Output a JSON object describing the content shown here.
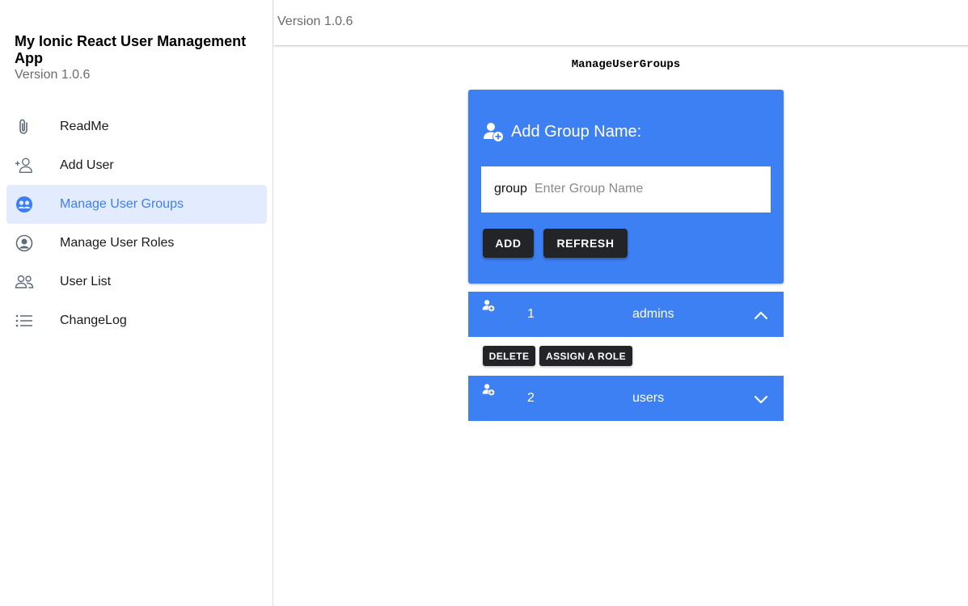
{
  "sidebar": {
    "app_title": "My Ionic React User Management App",
    "version": "Version 1.0.6",
    "items": [
      {
        "label": "ReadMe",
        "icon": "paperclip-icon"
      },
      {
        "label": "Add User",
        "icon": "person-add-icon"
      },
      {
        "label": "Manage User Groups",
        "icon": "people-circle-icon",
        "active": true
      },
      {
        "label": "Manage User Roles",
        "icon": "person-circle-icon"
      },
      {
        "label": "User List",
        "icon": "people-icon"
      },
      {
        "label": "ChangeLog",
        "icon": "list-icon"
      }
    ]
  },
  "header": {
    "version": "Version 1.0.6"
  },
  "main": {
    "page_title": "ManageUserGroups",
    "card": {
      "title": "Add Group Name:",
      "input_label": "group",
      "input_placeholder": "Enter Group Name",
      "input_value": "",
      "add_label": "ADD",
      "refresh_label": "REFRESH"
    },
    "groups": [
      {
        "id": "1",
        "name": "admins",
        "expanded": true
      },
      {
        "id": "2",
        "name": "users",
        "expanded": false
      }
    ],
    "actions": {
      "delete_label": "DELETE",
      "assign_role_label": "ASSIGN A ROLE"
    }
  },
  "colors": {
    "accent": "#3d80f4",
    "active_bg": "#e3ecfe",
    "active_text": "#3d7ff0",
    "button_dark": "#222428"
  }
}
